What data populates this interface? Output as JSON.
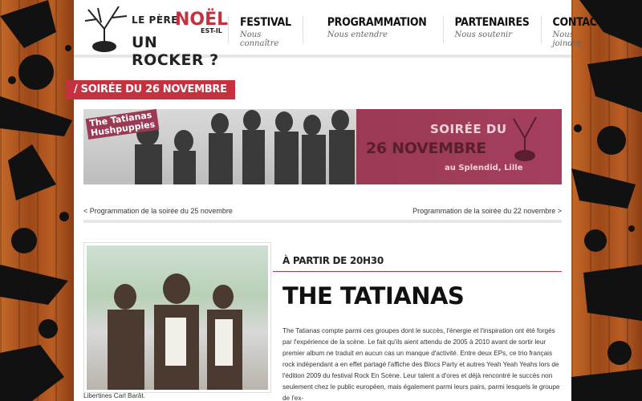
{
  "logo": {
    "line1": "LE PÈRE",
    "line2": "NOËL",
    "line3": "EST-IL",
    "line4": "UN ROCKER ?"
  },
  "nav": [
    {
      "title": "FESTIVAL",
      "sub": "Nous connaître"
    },
    {
      "title": "PROGRAMMATION",
      "sub": "Nous entendre"
    },
    {
      "title": "PARTENAIRES",
      "sub": "Nous soutenir"
    },
    {
      "title": "CONTACT",
      "sub": "Nous joindre"
    }
  ],
  "page_title": "/ SOIRÉE DU 26 NOVEMBRE",
  "banner": {
    "band1": "The Tatianas",
    "band2": "Hushpuppies",
    "soiree": "SOIRÉE DU",
    "date": "26 NOVEMBRE",
    "venue": "au Splendid, Lille"
  },
  "pager": {
    "prev": "< Programmation de la soirée du 25 novembre",
    "next": "Programmation de la soirée du 22 novembre >"
  },
  "event": {
    "hour": "À PARTIR DE 20H30",
    "band": "THE TATIANAS",
    "description": "The Tatianas compte parmi ces groupes dont le succès, l'énergie et l'inspiration ont été forgés par l'expérience de la scène. Le fait qu'ils aient attendu de 2005 à 2010 avant de sortir leur premier album ne traduit en aucun cas un manque d'activité. Entre deux EPs, ce trio français rock indépendant a en effet partagé l'affiche des Blocs Party et autres Yeah Yeah Yeahs lors de l'édition 2009 du festival Rock En Scène. Leur talent a d'ores et déjà rencontré le succès non seulement chez le public européen, mais également parmi leurs pairs, parmi lesquels le groupe de l'ex-",
    "description_tail": "Libertines Carl Barât."
  },
  "colors": {
    "accent": "#c4323f",
    "banner_pink": "#a4405e"
  }
}
